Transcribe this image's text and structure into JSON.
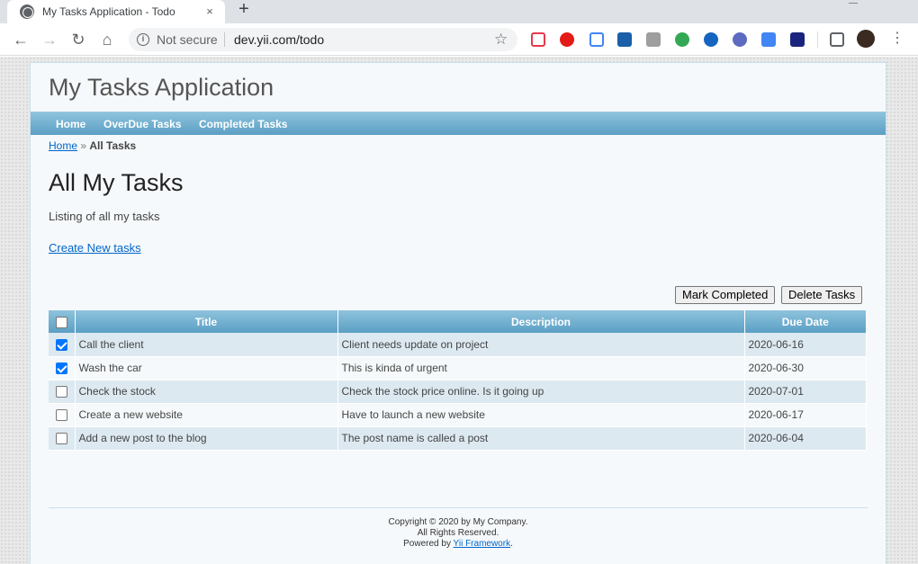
{
  "browser": {
    "tab_title": "My Tasks Application - Todo",
    "new_tab": "+",
    "close_glyph": "×",
    "omnibox": {
      "security_text": "Not secure",
      "url": "dev.yii.com/todo"
    },
    "icons": {
      "back": "←",
      "forward": "→",
      "reload": "↻",
      "home": "⌂",
      "info": "i",
      "star": "☆",
      "menu": "⋮"
    },
    "extensions": [
      {
        "name": "pocket-icon",
        "color": "#e6394c"
      },
      {
        "name": "opera-icon",
        "color": "#e41b17"
      },
      {
        "name": "eyedropper-icon",
        "color": "#4285f4"
      },
      {
        "name": "window-ext-icon",
        "color": "#1a5fa8"
      },
      {
        "name": "m-ext-icon",
        "color": "#9e9e9e"
      },
      {
        "name": "color-wheel-icon",
        "color": "#34a853"
      },
      {
        "name": "d-ext-icon",
        "color": "#1565c0"
      },
      {
        "name": "check-ext-icon",
        "color": "#5c6bc0"
      },
      {
        "name": "translate-ext-icon",
        "color": "#4285f4"
      },
      {
        "name": "download-ext-icon",
        "color": "#1a237e"
      },
      {
        "name": "playlist-icon",
        "color": "#5f6368"
      }
    ]
  },
  "app": {
    "title": "My Tasks Application",
    "menu": [
      "Home",
      "OverDue Tasks",
      "Completed Tasks"
    ],
    "breadcrumb": {
      "home": "Home",
      "separator": "»",
      "current": "All Tasks"
    }
  },
  "content": {
    "heading": "All My Tasks",
    "subtitle": "Listing of all my tasks",
    "create_link": "Create New tasks",
    "buttons": {
      "mark_completed": "Mark Completed",
      "delete": "Delete Tasks"
    }
  },
  "table": {
    "columns": [
      "Title",
      "Description",
      "Due Date"
    ],
    "rows": [
      {
        "checked": true,
        "title": "Call the client",
        "description": "Client needs update on project",
        "due": "2020-06-16"
      },
      {
        "checked": true,
        "title": "Wash the car",
        "description": "This is kinda of urgent",
        "due": "2020-06-30"
      },
      {
        "checked": false,
        "title": "Check the stock",
        "description": "Check the stock price online. Is it going up",
        "due": "2020-07-01"
      },
      {
        "checked": false,
        "title": "Create a new website",
        "description": "Have to launch a new website",
        "due": "2020-06-17"
      },
      {
        "checked": false,
        "title": "Add a new post to the blog",
        "description": "The post name is called a post",
        "due": "2020-06-04"
      }
    ]
  },
  "footer": {
    "copyright": "Copyright © 2020 by My Company.",
    "rights": "All Rights Reserved.",
    "powered_prefix": "Powered by ",
    "framework_link": "Yii Framework",
    "powered_suffix": "."
  }
}
